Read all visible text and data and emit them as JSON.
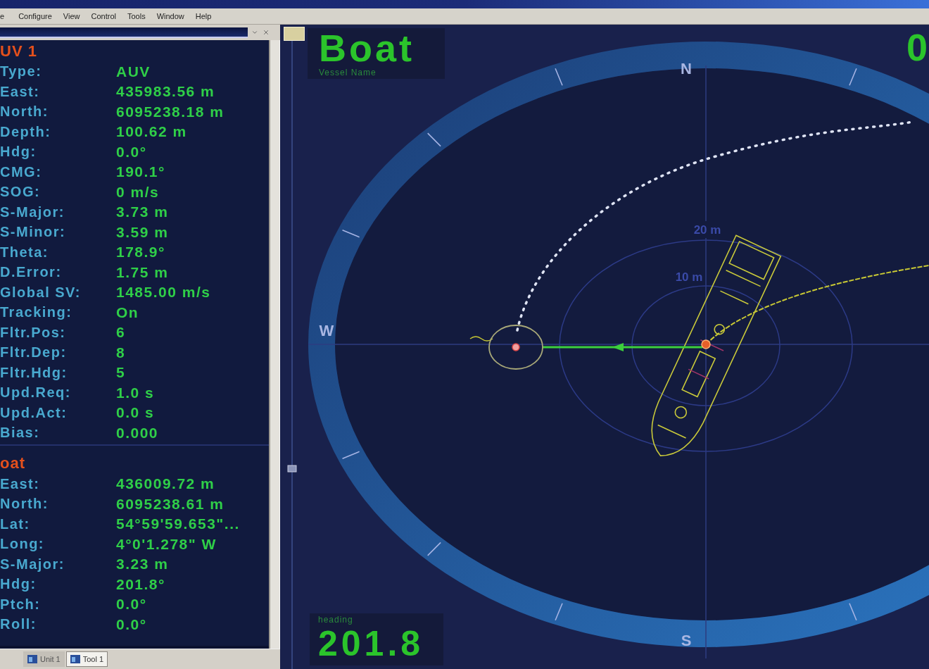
{
  "menu_bar": {
    "items": [
      {
        "label": "e"
      },
      {
        "label": "Configure"
      },
      {
        "label": "View"
      },
      {
        "label": "Control"
      },
      {
        "label": "Tools"
      },
      {
        "label": "Window"
      },
      {
        "label": "Help"
      }
    ]
  },
  "info_panel": {
    "sections": [
      {
        "title": "UV 1",
        "fields": [
          {
            "label": "Type:",
            "value": "AUV"
          },
          {
            "label": "East:",
            "value": "435983.56 m"
          },
          {
            "label": "North:",
            "value": "6095238.18 m"
          },
          {
            "label": "Depth:",
            "value": "100.62 m"
          },
          {
            "label": "Hdg:",
            "value": "0.0°"
          },
          {
            "label": "CMG:",
            "value": "190.1°"
          },
          {
            "label": "SOG:",
            "value": "0 m/s"
          },
          {
            "label": "S-Major:",
            "value": "3.73 m"
          },
          {
            "label": "S-Minor:",
            "value": "3.59 m"
          },
          {
            "label": "Theta:",
            "value": "178.9°"
          },
          {
            "label": "D.Error:",
            "value": "1.75 m"
          },
          {
            "label": "Global SV:",
            "value": "1485.00 m/s"
          },
          {
            "label": "Tracking:",
            "value": "On"
          },
          {
            "label": "Fltr.Pos:",
            "value": "6"
          },
          {
            "label": "Fltr.Dep:",
            "value": "8"
          },
          {
            "label": "Fltr.Hdg:",
            "value": "5"
          },
          {
            "label": "Upd.Req:",
            "value": "1.0 s"
          },
          {
            "label": "Upd.Act:",
            "value": "0.0 s"
          },
          {
            "label": "Bias:",
            "value": "0.000"
          }
        ]
      },
      {
        "title": "oat",
        "fields": [
          {
            "label": "East:",
            "value": "436009.72 m"
          },
          {
            "label": "North:",
            "value": "6095238.61 m"
          },
          {
            "label": "Lat:",
            "value": "54°59'59.653\"..."
          },
          {
            "label": "Long:",
            "value": "4°0'1.278\" W"
          },
          {
            "label": "S-Major:",
            "value": "3.23 m"
          },
          {
            "label": "Hdg:",
            "value": "201.8°"
          },
          {
            "label": "Ptch:",
            "value": "0.0°"
          },
          {
            "label": "Roll:",
            "value": "0.0°"
          }
        ]
      }
    ]
  },
  "panel_tabs": [
    {
      "label": "Unit 1",
      "selected": false
    },
    {
      "label": "Tool 1",
      "selected": true
    }
  ],
  "display": {
    "vessel": {
      "name": "Boat",
      "caption": "Vessel Name"
    },
    "corner_value": "0",
    "compass_labels": [
      {
        "label": "N",
        "kind": "north"
      },
      {
        "label": "S",
        "kind": "south"
      },
      {
        "label": "W",
        "kind": "west"
      }
    ],
    "range_rings": [
      {
        "label": "20 m",
        "kind": "outer"
      },
      {
        "label": "10 m",
        "kind": "inner"
      }
    ],
    "heading": {
      "caption": "heading",
      "value": "201.8"
    }
  }
}
